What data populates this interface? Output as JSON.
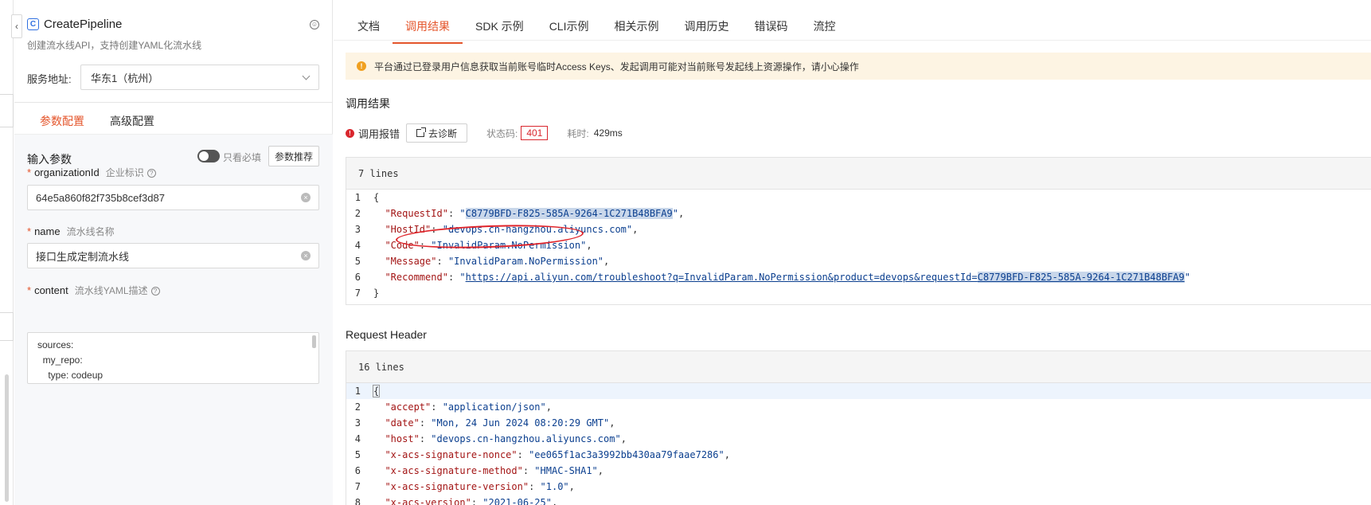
{
  "left": {
    "api_name": "CreatePipeline",
    "api_desc": "创建流水线API，支持创建YAML化流水线",
    "service_label": "服务地址:",
    "service_value": "华东1（杭州）",
    "tabs": [
      {
        "label": "参数配置"
      },
      {
        "label": "高级配置"
      }
    ],
    "input_params_label": "输入参数",
    "only_required_label": "只看必填",
    "recommend_label": "参数推荐",
    "fields": [
      {
        "name": "organizationId",
        "desc": "企业标识",
        "value": "64e5a860f82f735b8cef3d87"
      },
      {
        "name": "name",
        "desc": "流水线名称",
        "value": "接口生成定制流水线"
      },
      {
        "name": "content",
        "desc": "流水线YAML描述"
      }
    ],
    "yaml_lines": [
      "sources:",
      "  my_repo:",
      "    type: codeup"
    ]
  },
  "right": {
    "tabs": [
      {
        "label": "文档"
      },
      {
        "label": "调用结果"
      },
      {
        "label": "SDK 示例"
      },
      {
        "label": "CLI示例"
      },
      {
        "label": "相关示例"
      },
      {
        "label": "调用历史"
      },
      {
        "label": "错误码"
      },
      {
        "label": "流控"
      }
    ],
    "notice": "平台通过已登录用户信息获取当前账号临时Access Keys、发起调用可能对当前账号发起线上资源操作，请小心操作",
    "result_title": "调用结果",
    "status_text": "调用报错",
    "diagnose_label": "去诊断",
    "status_code_label": "状态码:",
    "status_code": "401",
    "time_label": "耗时:",
    "time_value": "429ms",
    "result_block": {
      "header": "7 lines",
      "request_id": "C8779BFD-F825-585A-9264-1C271B48BFA9",
      "host_id": "devops.cn-hangzhou.aliyuncs.com",
      "code": "InvalidParam.NoPermission",
      "message": "InvalidParam.NoPermission",
      "recommend_url": "https://api.aliyun.com/troubleshoot?q=InvalidParam.NoPermission&product=devops&requestId=",
      "recommend_id": "C8779BFD-F825-585A-9264-1C271B48BFA9"
    },
    "header_title": "Request Header",
    "header_block": {
      "header": "16 lines",
      "entries": [
        {
          "k": "\"accept\"",
          "v": "\"application/json\""
        },
        {
          "k": "\"date\"",
          "v": "\"Mon, 24 Jun 2024 08:20:29 GMT\""
        },
        {
          "k": "\"host\"",
          "v": "\"devops.cn-hangzhou.aliyuncs.com\""
        },
        {
          "k": "\"x-acs-signature-nonce\"",
          "v": "\"ee065f1ac3a3992bb430aa79faae7286\""
        },
        {
          "k": "\"x-acs-signature-method\"",
          "v": "\"HMAC-SHA1\""
        },
        {
          "k": "\"x-acs-signature-version\"",
          "v": "\"1.0\""
        },
        {
          "k": "\"x-acs-version\"",
          "v": "\"2021-06-25\""
        }
      ]
    }
  }
}
